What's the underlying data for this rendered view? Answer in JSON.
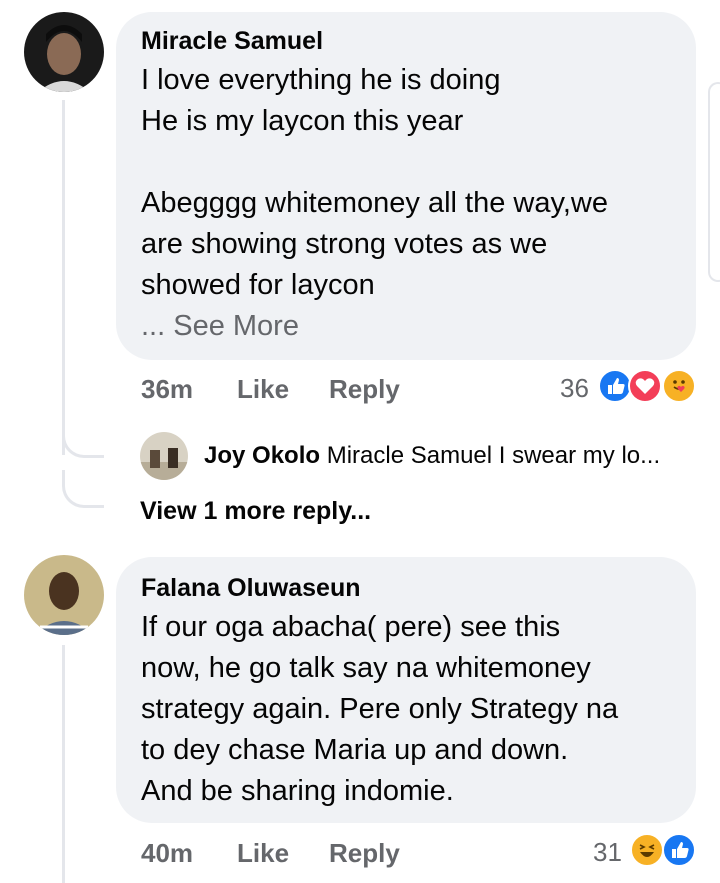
{
  "comments": [
    {
      "author": "Miracle Samuel",
      "lines": [
        "I love everything he is doing",
        "He is my laycon this year",
        "",
        "Abegggg whitemoney all the way,we",
        "are showing strong votes as we",
        "showed for laycon"
      ],
      "see_more": "... See More",
      "time": "36m",
      "like_label": "Like",
      "reply_label": "Reply",
      "reaction_count": "36",
      "reactions": [
        "like-icon",
        "love-icon",
        "care-icon"
      ]
    },
    {
      "author": "Falana Oluwaseun",
      "lines": [
        "If our oga abacha( pere) see this",
        "now, he go talk say na whitemoney",
        "strategy again. Pere only Strategy na",
        "to dey chase Maria up and down.",
        "And be sharing indomie."
      ],
      "time": "40m",
      "like_label": "Like",
      "reply_label": "Reply",
      "reaction_count": "31",
      "reactions": [
        "haha-icon",
        "like-icon"
      ]
    }
  ],
  "reply_preview": {
    "name": "Joy Okolo",
    "text": "Miracle Samuel I swear my lo..."
  },
  "view_more": "View 1 more reply...",
  "colors": {
    "like_blue": "#1877f2",
    "love_red": "#f33e58",
    "haha_yellow": "#f7b125",
    "bubble": "#f0f2f5",
    "meta_gray": "#65676b"
  }
}
